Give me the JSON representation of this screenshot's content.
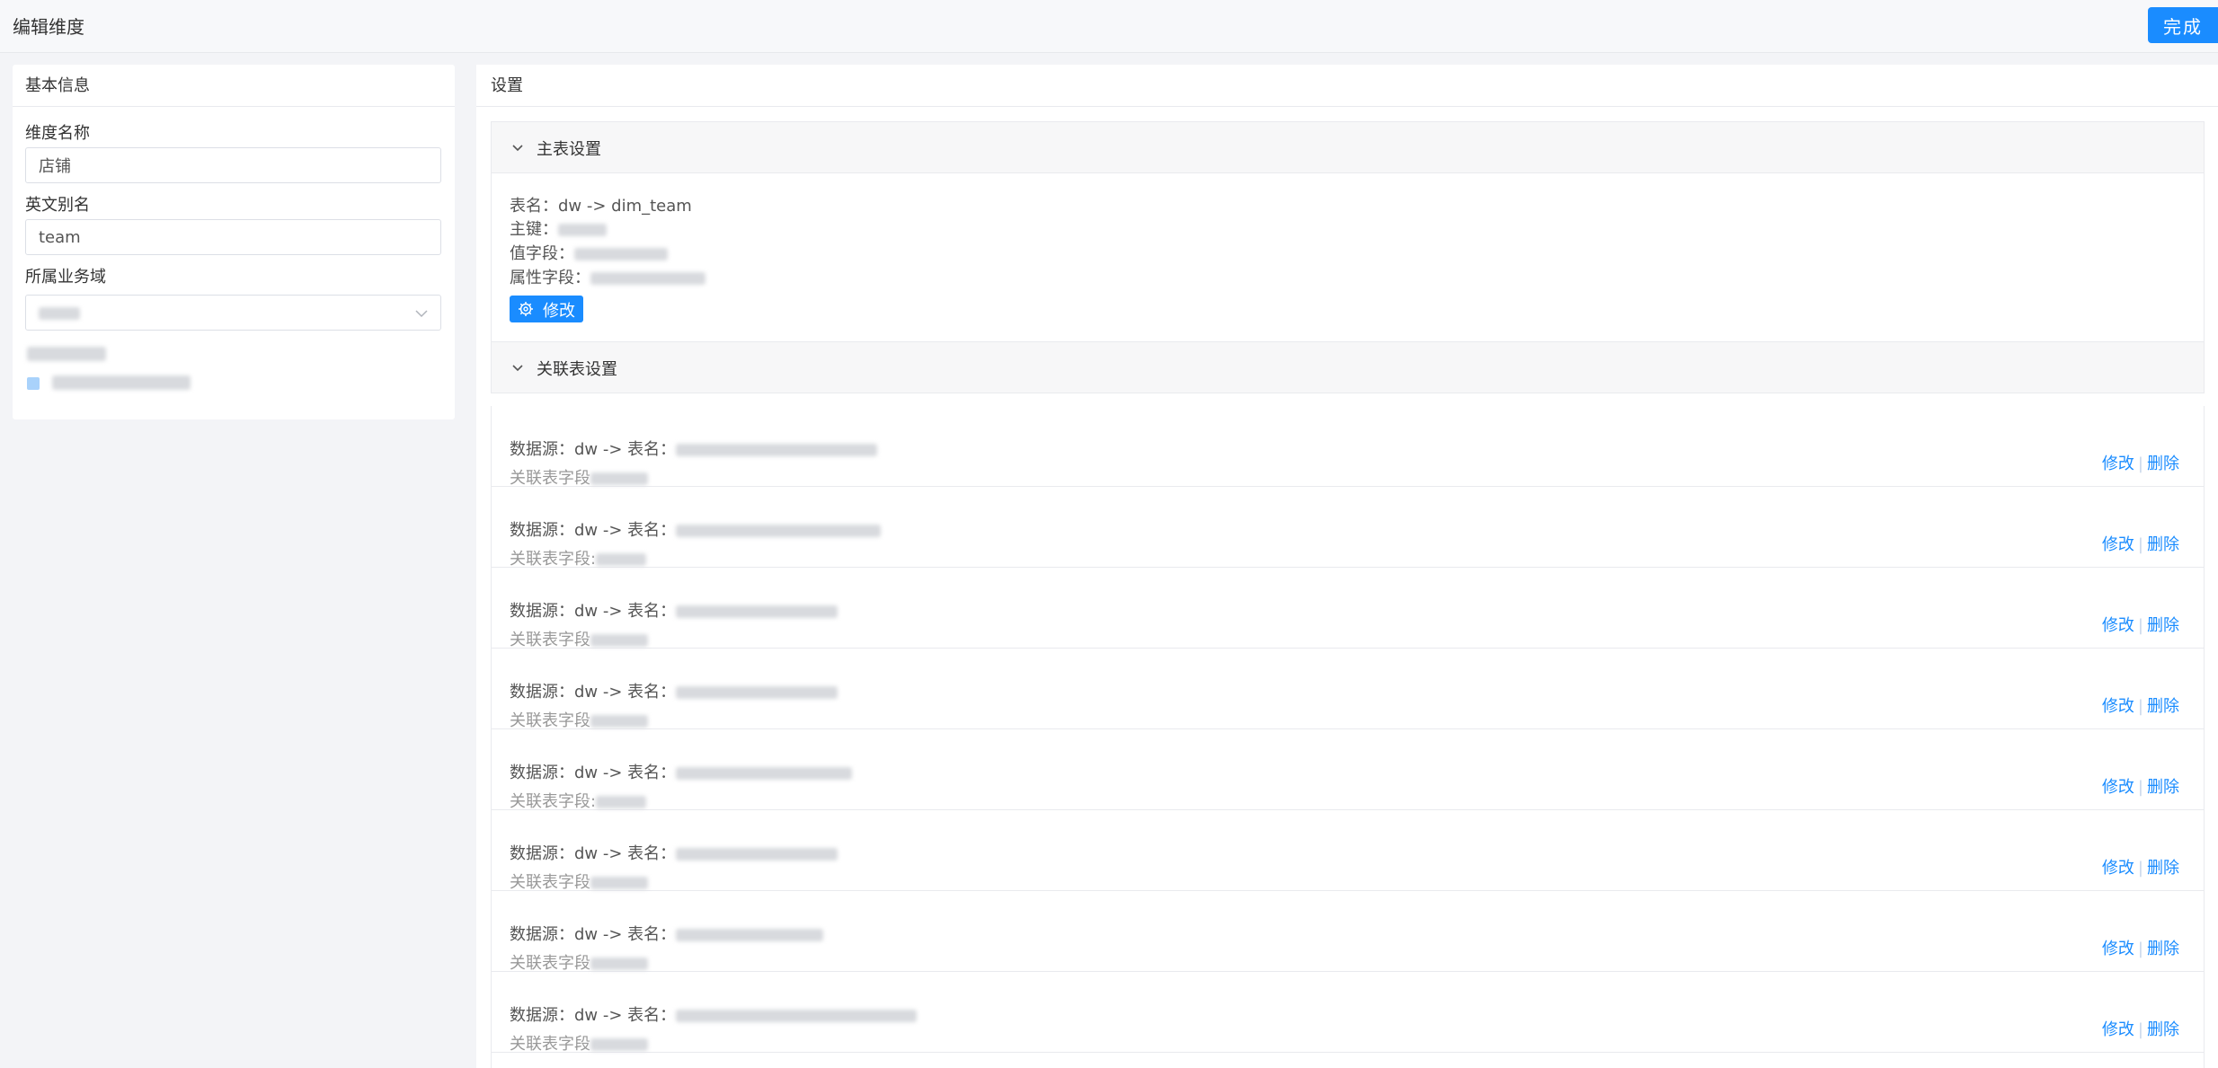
{
  "header": {
    "title": "编辑维度",
    "done_label": "完成"
  },
  "basic_info": {
    "title": "基本信息",
    "dimension_name_label": "维度名称",
    "dimension_name_value": "店铺",
    "alias_label": "英文别名",
    "alias_value": "team",
    "domain_label": "所属业务域"
  },
  "settings": {
    "title": "设置",
    "main_table": {
      "title": "主表设置",
      "table_label": "表名：",
      "table_value": "dw -> dim_team",
      "primary_key_label": "主键：",
      "value_field_label": "值字段：",
      "attribute_field_label": "属性字段：",
      "edit_label": "修改"
    },
    "related": {
      "title": "关联表设置",
      "items": [
        {
          "source": "数据源：dw -> 表名：",
          "field_label": "关联表字段",
          "edit": "修改",
          "delete": "删除"
        },
        {
          "source": "数据源：dw -> 表名：",
          "field_label": "关联表字段:",
          "edit": "修改",
          "delete": "删除"
        },
        {
          "source": "数据源：dw -> 表名：",
          "field_label": "关联表字段",
          "edit": "修改",
          "delete": "删除"
        },
        {
          "source": "数据源：dw -> 表名：",
          "field_label": "关联表字段",
          "edit": "修改",
          "delete": "删除"
        },
        {
          "source": "数据源：dw -> 表名：",
          "field_label": "关联表字段:",
          "edit": "修改",
          "delete": "删除"
        },
        {
          "source": "数据源：dw -> 表名：",
          "field_label": "关联表字段",
          "edit": "修改",
          "delete": "删除"
        },
        {
          "source": "数据源：dw -> 表名：",
          "field_label": "关联表字段",
          "edit": "修改",
          "delete": "删除"
        },
        {
          "source": "数据源：dw -> 表名：",
          "field_label": "关联表字段",
          "edit": "修改",
          "delete": "删除"
        }
      ]
    }
  },
  "icons": {
    "collapse": "chevron-down-icon",
    "settings": "gear-icon"
  },
  "colors": {
    "primary": "#1a8cff",
    "border": "#e9eaee",
    "background": "#f3f4f7"
  }
}
